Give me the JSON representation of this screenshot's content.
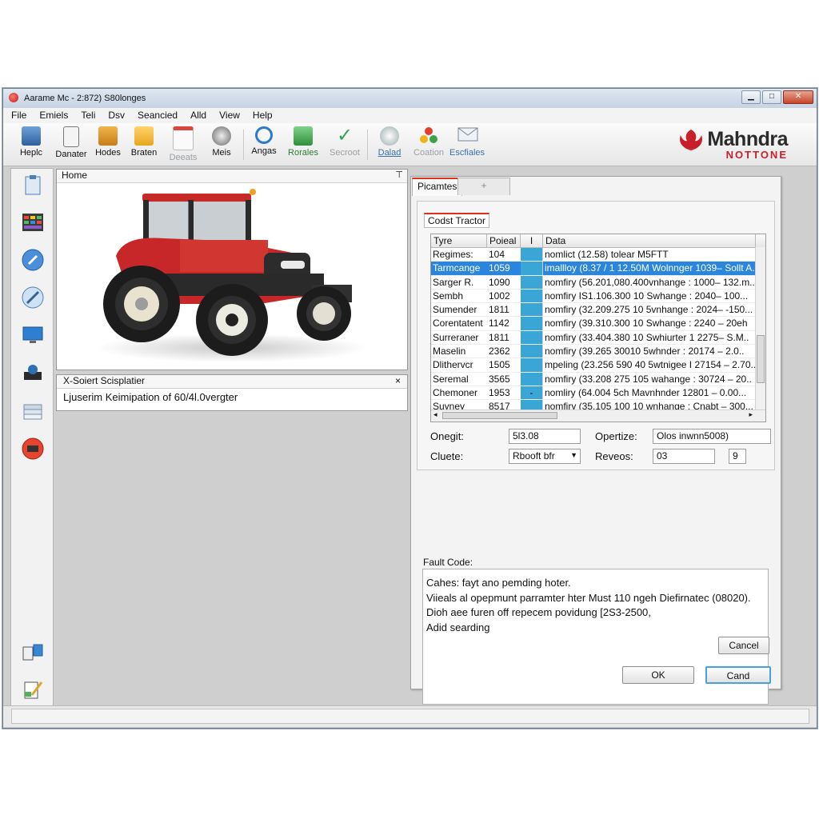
{
  "window": {
    "title": "Aarame Mc - 2:872) S80longes"
  },
  "menu": [
    "File",
    "Emiels",
    "Teli",
    "Dsv",
    "Seancied",
    "Alld",
    "View",
    "Help"
  ],
  "toolbar": [
    {
      "label": "Heplc",
      "icon": "help-monitor-icon"
    },
    {
      "label": "Danater",
      "icon": "document-icon"
    },
    {
      "label": "Hodes",
      "icon": "briefcase-icon"
    },
    {
      "label": "Braten",
      "icon": "notebook-icon"
    },
    {
      "label": "Deeats",
      "icon": "calendar-icon"
    },
    {
      "label": "Meis",
      "icon": "gauge-icon"
    },
    {
      "label": "Angas",
      "icon": "magnifier-icon"
    },
    {
      "label": "Rorales",
      "icon": "report-icon"
    },
    {
      "label": "Secroot",
      "icon": "checkmark-icon"
    },
    {
      "label": "Dalad",
      "icon": "camera-icon"
    },
    {
      "label": "Coation",
      "icon": "color-balls-icon"
    },
    {
      "label": "Escfiales",
      "icon": "envelope-icon"
    }
  ],
  "brand": {
    "name": "Mahndra",
    "sub": "NOTTONE"
  },
  "home": {
    "title": "Home",
    "pin": "⊤"
  },
  "sp": {
    "title": "X-Soiert Scisplatier",
    "close": "×",
    "body": "Ljuserim Keimipation of 60/4l.0vergter"
  },
  "dialog": {
    "tab": "Picamtes",
    "tab2": "+",
    "group_label": "Codst Tractor",
    "columns": [
      "Tyre",
      "Poieal",
      "I",
      "Data"
    ],
    "rows": [
      [
        "Regimes:",
        "104",
        "",
        "nomlict (12.58) tolear M5FTT"
      ],
      [
        "Tarmcange",
        "1059",
        "",
        "imallloy (8.37 / 1 12.50M Wolnnger 1039– Sollt A."
      ],
      [
        "Sarger R.",
        "1090",
        "",
        "nomfiry (56.201,080.400vnhange : 1000– 132.m..."
      ],
      [
        "Sembh",
        "1002",
        "",
        "nomfiry IS1.106.300 10 Swhange : 2040– 100..."
      ],
      [
        "Sumender",
        "1811",
        "",
        "nomfiry (32.209.275 10 5vnhange : 2024– -150..."
      ],
      [
        "Corentatent",
        "1142",
        "",
        "nomfiry (39.310.300 10 Swhange : 2240 – 20eh"
      ],
      [
        "Surreraner",
        "1811",
        "",
        "nomfiry (33.404.380 10 Swhiurter 1 2275– S.M.."
      ],
      [
        "Maselin",
        "2362",
        "",
        "nomfiry (39.265 30010 5whnder : 20174 – 2.0.."
      ],
      [
        "Dlithervcr",
        "1505",
        "",
        "mpeling (23.256 590 40 5wtnigee I 27154 – 2.70..."
      ],
      [
        "Seremal",
        "3565",
        "",
        "nomfiry (33.208 275 105 wahange : 30724 – 20.."
      ],
      [
        "Chemoner",
        "1953",
        "-",
        "nomliry (64.004 5ch Mavnhnder 12801 – 0.00..."
      ],
      [
        "Suyney",
        "8517",
        "",
        "nomfiry (35.105 100 10 wnhange : Cnabt – 300..."
      ]
    ],
    "fields": {
      "onegit_label": "Onegit:",
      "onegit_value": "5l3.08",
      "opertize_label": "Opertize:",
      "opertize_value": "Olos inwnn5008)",
      "cluete_label": "Cluete:",
      "cluete_value": "Rbooft bfr",
      "reveos_label": "Reveos:",
      "reveos_value": "03",
      "reveos_count": "9"
    },
    "fault_label": "Fault Code:",
    "fault_lines": [
      "Cahes: fayt ano pemding hoter.",
      "Viieals al opepmunt parramter hter Must 110 ngeh Diefirnatec (08020).",
      "Dioh aee furen off repecem povidung [2S3-2500,",
      "Adid searding"
    ],
    "cancel_label": "Cancel",
    "ok_label": "OK",
    "cand_label": "Cand"
  },
  "colors": {
    "accent": "#d7311f",
    "selection": "#2a85de",
    "brand_red": "#c8202a"
  }
}
